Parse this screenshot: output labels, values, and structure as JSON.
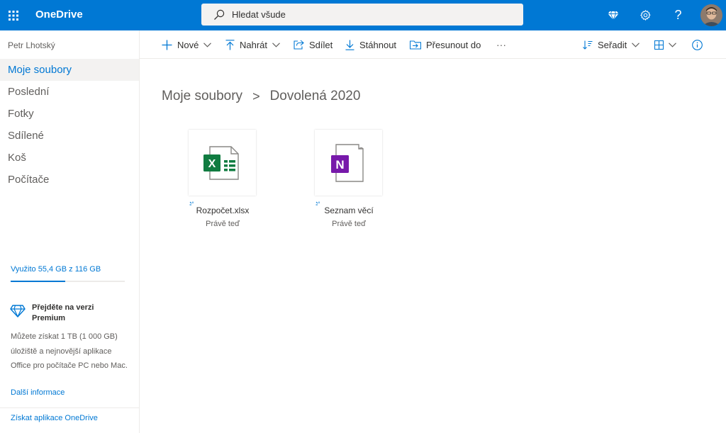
{
  "header": {
    "app_name": "OneDrive",
    "search_placeholder": "Hledat všude",
    "help_label": "?"
  },
  "sidebar": {
    "user_name": "Petr Lhotský",
    "nav": [
      {
        "label": "Moje soubory",
        "active": true
      },
      {
        "label": "Poslední"
      },
      {
        "label": "Fotky"
      },
      {
        "label": "Sdílené"
      },
      {
        "label": "Koš"
      },
      {
        "label": "Počítače"
      }
    ],
    "storage": {
      "label": "Využito 55,4 GB z 116 GB",
      "used_fraction": 0.478
    },
    "premium": {
      "title": "Přejděte na verzi Premium",
      "description": "Můžete získat 1 TB (1 000 GB) úložiště a nejnovější aplikace Office pro počítače PC nebo Mac.",
      "more_info": "Další informace"
    },
    "get_app": "Získat aplikace OneDrive"
  },
  "commandbar": {
    "new": "Nové",
    "upload": "Nahrát",
    "share": "Sdílet",
    "download": "Stáhnout",
    "move_to": "Přesunout do",
    "more": "···",
    "sort": "Seřadit"
  },
  "breadcrumb": {
    "parent": "Moje soubory",
    "separator": ">",
    "current": "Dovolená 2020"
  },
  "files": [
    {
      "name": "Rozpočet.xlsx",
      "modified": "Právě teď",
      "type": "excel",
      "icon_letter": "X",
      "color": "#107c41"
    },
    {
      "name": "Seznam věcí",
      "modified": "Právě teď",
      "type": "onenote",
      "icon_letter": "N",
      "color": "#7719aa"
    }
  ],
  "colors": {
    "accent": "#0078d4",
    "excel": "#107c41",
    "onenote": "#7719aa"
  }
}
